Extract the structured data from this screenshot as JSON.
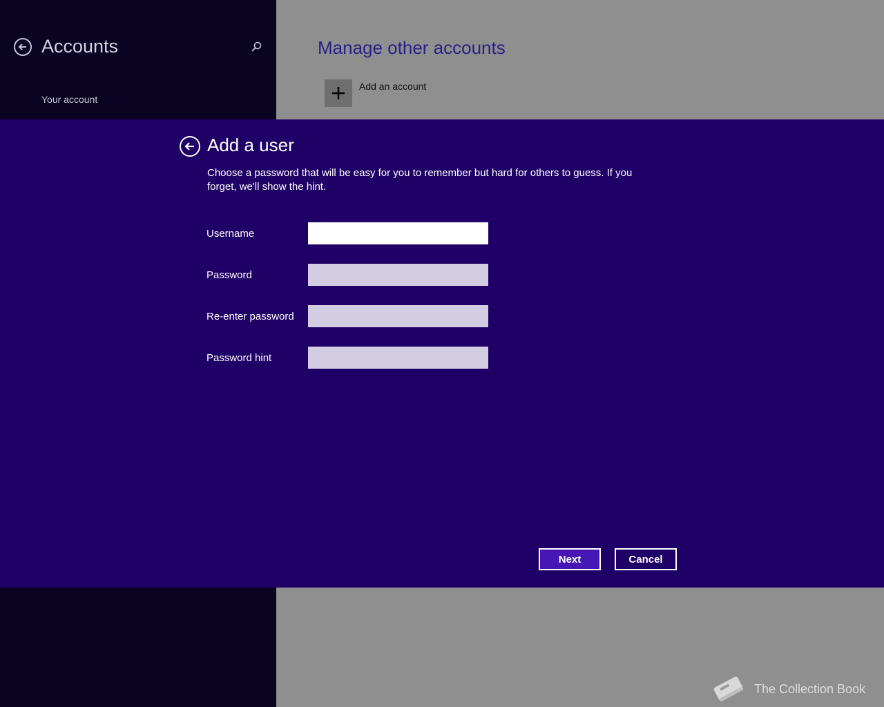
{
  "sidebar": {
    "title": "Accounts",
    "items": [
      {
        "label": "Your account"
      }
    ]
  },
  "main": {
    "title": "Manage other accounts",
    "add_account_label": "Add an account"
  },
  "dialog": {
    "title": "Add a user",
    "description": "Choose a password that will be easy for you to remember but hard for others to guess. If you forget, we'll show the hint.",
    "fields": [
      {
        "label": "Username",
        "value": "",
        "placeholder": ""
      },
      {
        "label": "Password",
        "value": "",
        "placeholder": ""
      },
      {
        "label": "Re-enter password",
        "value": "",
        "placeholder": ""
      },
      {
        "label": "Password hint",
        "value": "",
        "placeholder": ""
      }
    ],
    "next_label": "Next",
    "cancel_label": "Cancel"
  },
  "watermark": {
    "text": "The Collection Book",
    "icon": "book-icon"
  },
  "icons": {
    "back": "back-arrow-icon",
    "search": "search-icon",
    "add": "plus-icon"
  },
  "colors": {
    "dialog_bg": "#1e0066",
    "sidebar_bg": "#0b0322",
    "content_bg": "#8f8f8f",
    "accent": "#4617b4",
    "title_accent": "#2b1f8a"
  }
}
